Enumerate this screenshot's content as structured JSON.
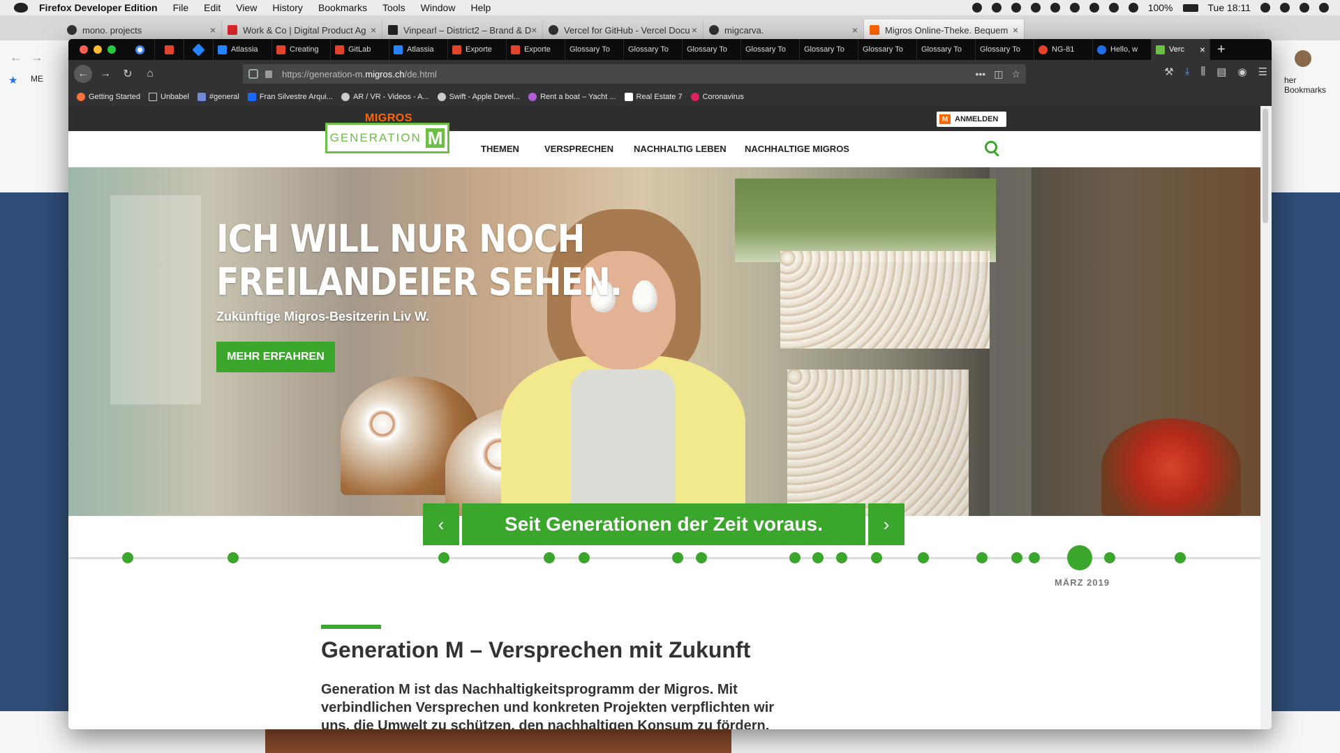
{
  "menubar": {
    "app": "Firefox Developer Edition",
    "items": [
      "File",
      "Edit",
      "View",
      "History",
      "Bookmarks",
      "Tools",
      "Window",
      "Help"
    ],
    "battery": "100%",
    "clock": "Tue 18:11"
  },
  "bg_tabs": [
    {
      "title": "mono. projects"
    },
    {
      "title": "Work & Co | Digital Product Ag"
    },
    {
      "title": "Vinpearl – District2 – Brand & D"
    },
    {
      "title": "Vercel for GitHub - Vercel Docu"
    },
    {
      "title": "migcarva."
    },
    {
      "title": "Migros Online-Theke. Bequem"
    }
  ],
  "bg_bookmark_label": "ME",
  "bg_other_bookmarks": "her Bookmarks",
  "tabs": [
    {
      "title": "",
      "color": "#4285f4"
    },
    {
      "title": "",
      "color": "#e2432a"
    },
    {
      "title": "",
      "color": "#2684ff"
    },
    {
      "title": "Atlassia",
      "color": "#2684ff"
    },
    {
      "title": "Creating",
      "color": "#e2432a"
    },
    {
      "title": "GitLab",
      "color": "#e2432a"
    },
    {
      "title": "Atlassia",
      "color": "#2684ff"
    },
    {
      "title": "Exporte",
      "color": "#e2432a"
    },
    {
      "title": "Exporte",
      "color": "#e2432a"
    },
    {
      "title": "Glossary To",
      "color": "#0c0c0d"
    },
    {
      "title": "Glossary To",
      "color": "#0c0c0d"
    },
    {
      "title": "Glossary To",
      "color": "#0c0c0d"
    },
    {
      "title": "Glossary To",
      "color": "#0c0c0d"
    },
    {
      "title": "Glossary To",
      "color": "#0c0c0d"
    },
    {
      "title": "Glossary To",
      "color": "#0c0c0d"
    },
    {
      "title": "Glossary To",
      "color": "#0c0c0d"
    },
    {
      "title": "Glossary To",
      "color": "#0c0c0d"
    },
    {
      "title": "NG-81",
      "color": "#e2432a"
    },
    {
      "title": "Hello, w",
      "color": "#1f6feb"
    },
    {
      "title": "Verc",
      "color": "#6cbe45"
    }
  ],
  "url": {
    "prefix": "https://generation-m.",
    "domain": "migros.ch",
    "path": "/de.html"
  },
  "bookmarks": [
    "Getting Started",
    "Unbabel",
    "#general",
    "Fran Silvestre Arqui...",
    "AR / VR - Videos - A...",
    "Swift - Apple Devel...",
    "Rent a boat – Yacht ...",
    "Real Estate 7",
    "Coronavirus"
  ],
  "site": {
    "brand": "MIGROS",
    "login_badge": "M",
    "login": "ANMELDEN",
    "logo_text": "GENERATION",
    "logo_letter": "M",
    "nav": [
      "THEMEN",
      "VERSPRECHEN",
      "NACHHALTIG LEBEN",
      "NACHHALTIGE MIGROS"
    ]
  },
  "hero": {
    "title_line1": "ICH WILL NUR NOCH",
    "title_line2": "FREILANDEIER SEHEN.",
    "subtitle": "Zukünftige Migros-Besitzerin Liv W.",
    "cta": "MEHR ERFAHREN"
  },
  "banner": {
    "prev": "‹",
    "text": "Seit Generationen der Zeit voraus.",
    "next": "›"
  },
  "timeline": {
    "active_label": "MÄRZ 2019"
  },
  "section": {
    "title": "Generation M – Versprechen mit Zukunft",
    "body": "Generation M ist das Nachhaltigkeitsprogramm der Migros. Mit verbindlichen Versprechen und konkreten Projekten verpflichten wir uns, die Umwelt zu schützen, den nachhaltigen Konsum zu fördern,"
  },
  "colors": {
    "green": "#3aa62b",
    "logo_green": "#6cbe45",
    "migros_orange": "#ff6600",
    "dark": "#2e2e2e"
  }
}
